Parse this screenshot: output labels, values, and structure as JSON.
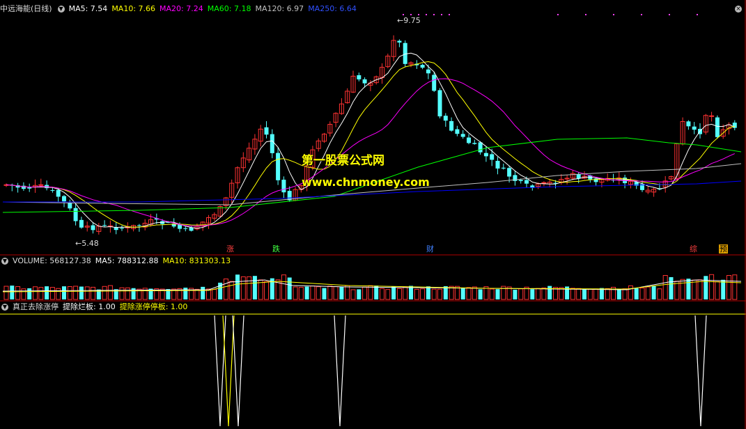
{
  "price_header": {
    "stock": "中远海能(日线)",
    "ma5": "MA5: 7.54",
    "ma10": "MA10: 7.66",
    "ma20": "MA20: 7.24",
    "ma60": "MA60: 7.18",
    "ma120": "MA120: 6.97",
    "ma250": "MA250: 6.64"
  },
  "volume_header": {
    "volume": "VOLUME: 568127.38",
    "ma5": "MA5: 788312.88",
    "ma10": "MA10: 831303.13"
  },
  "indicator_header": {
    "name": "真正去除涨停",
    "param1": "提除烂板: 1.00",
    "param2": "提除涨停停板: 1.00"
  },
  "annotations": {
    "high": "9.75",
    "low": "5.48"
  },
  "markers": [
    {
      "text": "涨",
      "color": "#ff4040"
    },
    {
      "text": "跌",
      "color": "#40ff40"
    },
    {
      "text": "财",
      "color": "#4080ff"
    },
    {
      "text": "综",
      "color": "#ff4040"
    },
    {
      "text": "预",
      "color": "#ffcc00"
    }
  ],
  "watermark": {
    "title": "第一股票公式网",
    "url": "www.chnmoney.com"
  },
  "colors": {
    "up": "#ff3232",
    "down": "#54ffff",
    "ma5": "#ffffff",
    "ma10": "#ffff00",
    "ma20": "#ff00ff",
    "ma60": "#00ff00",
    "ma120": "#c0c0c0",
    "ma250": "#0000ff",
    "frame": "#b00000"
  },
  "icons": {
    "collapse": "circle-down-icon",
    "corner": "close-circle-icon"
  }
}
